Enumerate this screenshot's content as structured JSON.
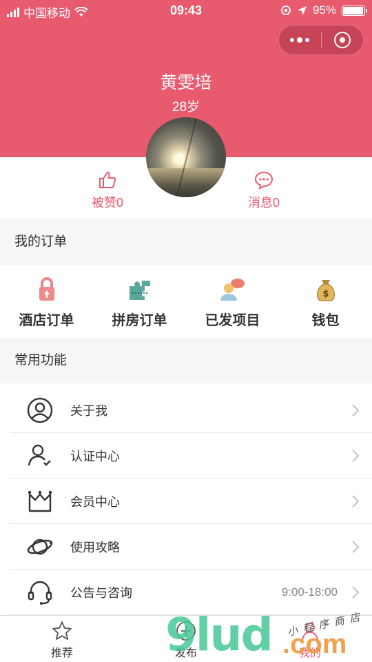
{
  "status_bar": {
    "carrier": "中国移动",
    "time": "09:43",
    "battery": "95%"
  },
  "profile": {
    "name": "黄雯培",
    "age": "28岁",
    "likes_label": "被赞0",
    "messages_label": "消息0"
  },
  "orders": {
    "title": "我的订单",
    "items": [
      {
        "label": "酒店订单",
        "icon": "lock-icon"
      },
      {
        "label": "拼房订单",
        "icon": "puzzle-icon"
      },
      {
        "label": "已发项目",
        "icon": "person-chat-icon"
      },
      {
        "label": "钱包",
        "icon": "money-bag-icon"
      }
    ]
  },
  "features": {
    "title": "常用功能",
    "items": [
      {
        "label": "关于我",
        "icon": "user-circle-icon",
        "extra": ""
      },
      {
        "label": "认证中心",
        "icon": "user-check-icon",
        "extra": ""
      },
      {
        "label": "会员中心",
        "icon": "crown-icon",
        "extra": ""
      },
      {
        "label": "使用攻略",
        "icon": "planet-icon",
        "extra": ""
      },
      {
        "label": "公告与咨询",
        "icon": "headset-icon",
        "extra": "9:00-18:00"
      }
    ]
  },
  "tabbar": {
    "items": [
      {
        "label": "推荐",
        "icon": "star-icon"
      },
      {
        "label": "发布",
        "icon": "plus-circle-icon"
      },
      {
        "label": "我的",
        "icon": "user-icon"
      }
    ]
  },
  "watermark": {
    "main": "9lud",
    "suffix": ".com",
    "tagline": "小程序商店"
  },
  "colors": {
    "brand": "#e85a6e",
    "background": "#f6f6f6"
  }
}
